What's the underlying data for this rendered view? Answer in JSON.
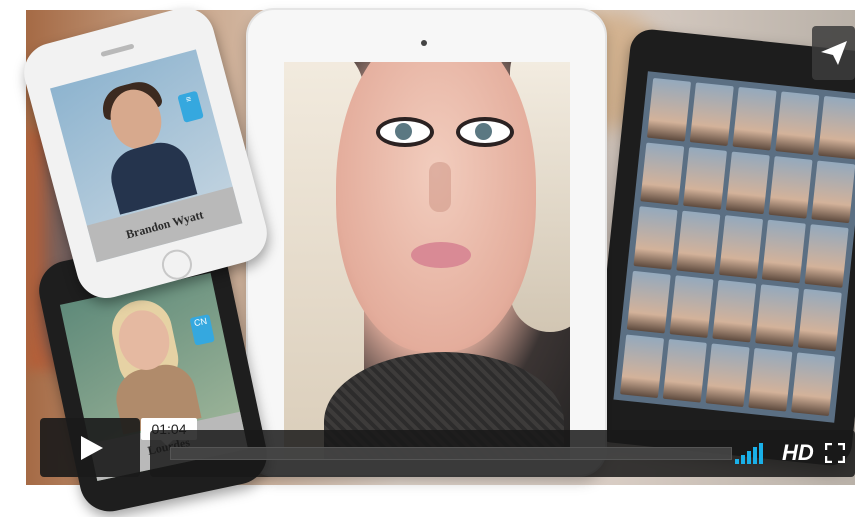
{
  "player": {
    "current_time": "01:04",
    "progress_fraction": 0.0,
    "hd_label": "HD",
    "colors": {
      "accent": "#1ab0e8",
      "bar": "#1a1a1a"
    }
  },
  "scene": {
    "phone_top_name": "Brandon Wyatt",
    "phone_bottom_name": "Lourdes",
    "badge_text": "CN"
  },
  "icons": {
    "share": "paper-plane-icon",
    "play": "play-icon",
    "volume": "volume-bars-icon",
    "fullscreen": "fullscreen-icon"
  }
}
